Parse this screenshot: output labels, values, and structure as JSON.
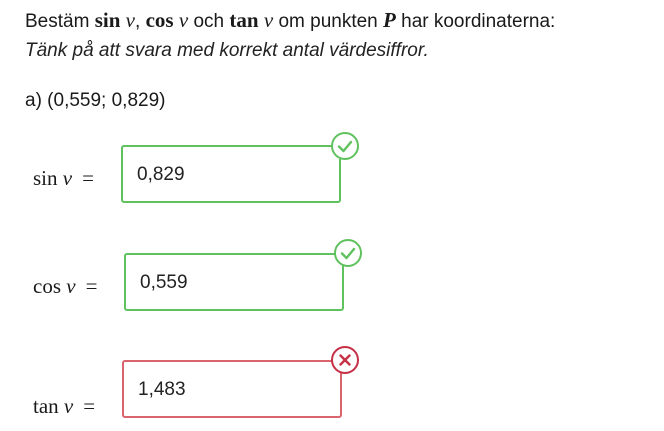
{
  "instruction": {
    "prefix": "Bestäm ",
    "sin": "sin",
    "v": "v",
    "comma": ", ",
    "cos": "cos",
    "och": " och ",
    "tan": "tan",
    "om": " om punkten ",
    "P": "P",
    "suffix": " har koordinaterna:",
    "hint": "Tänk på att svara med korrekt antal värdesiffror."
  },
  "part_label": "a) (0,559; 0,829)",
  "rows": [
    {
      "func": "sin",
      "var": "v",
      "eq": "=",
      "value": "0,829",
      "status": "correct",
      "status_icon": "check-icon"
    },
    {
      "func": "cos",
      "var": "v",
      "eq": "=",
      "value": "0,559",
      "status": "correct",
      "status_icon": "check-icon"
    },
    {
      "func": "tan",
      "var": "v",
      "eq": "=",
      "value": "1,483",
      "status": "incorrect",
      "status_icon": "cross-icon"
    }
  ],
  "colors": {
    "correct_border": "#5fc25e",
    "incorrect_border": "#d9646e",
    "incorrect_badge": "#c62f45"
  }
}
